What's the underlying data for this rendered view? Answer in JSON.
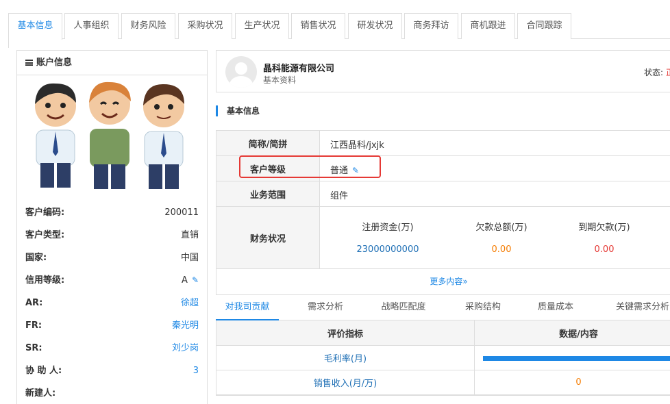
{
  "tabs": [
    "基本信息",
    "人事组织",
    "财务风险",
    "采购状况",
    "生产状况",
    "销售状况",
    "研发状况",
    "商务拜访",
    "商机跟进",
    "合同跟踪"
  ],
  "left": {
    "header": "账户信息",
    "rows": [
      {
        "label": "客户编码:",
        "value": "200011"
      },
      {
        "label": "客户类型:",
        "value": "直销"
      },
      {
        "label": "国家:",
        "value": "中国"
      },
      {
        "label": "信用等级:",
        "value": "A"
      },
      {
        "label": "AR:",
        "value": "徐超"
      },
      {
        "label": "FR:",
        "value": "秦光明"
      },
      {
        "label": "SR:",
        "value": "刘少岗"
      },
      {
        "label": "协 助 人:",
        "value": "3"
      },
      {
        "label": "新建人:",
        "value": ""
      }
    ]
  },
  "profile": {
    "company": "晶科能源有限公司",
    "subtitle": "基本资料",
    "status_label": "状态:",
    "status_value": "正"
  },
  "section_title": "基本信息",
  "info": {
    "short_label": "简称/简拼",
    "short_value": "江西晶科/jxjk",
    "level_label": "客户等级",
    "level_value": "普通",
    "scope_label": "业务范围",
    "scope_value": "组件",
    "finance_label": "财务状况",
    "finance_headers": [
      "注册资金(万)",
      "欠款总额(万)",
      "到期欠款(万)"
    ],
    "finance_values": [
      "23000000000",
      "0.00",
      "0.00"
    ],
    "more": "更多内容»"
  },
  "subtabs": [
    "对我司贡献",
    "需求分析",
    "战略匹配度",
    "采购结构",
    "质量成本",
    "关键需求分析"
  ],
  "eval": {
    "col1": "评价指标",
    "col2": "数据/内容",
    "rows": [
      {
        "label": "毛利率(月)",
        "value": ""
      },
      {
        "label": "销售收入(月/万)",
        "value": "0"
      }
    ]
  },
  "colors": {
    "accent": "#1e88e5",
    "danger": "#e53935",
    "orange": "#f57c00"
  }
}
